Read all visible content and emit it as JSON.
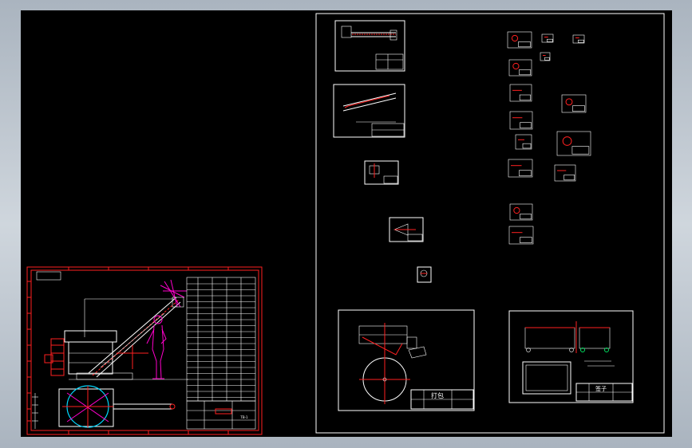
{
  "drawing": {
    "main_sheet_code": "TB-1",
    "large_part_titles": [
      "打包",
      "签子"
    ]
  },
  "colors": {
    "background": "#000000",
    "line": "#ffffff",
    "border_red": "#ff2020",
    "figure_magenta": "#ff00cc",
    "cyan": "#00d8ff",
    "green": "#00e060"
  }
}
